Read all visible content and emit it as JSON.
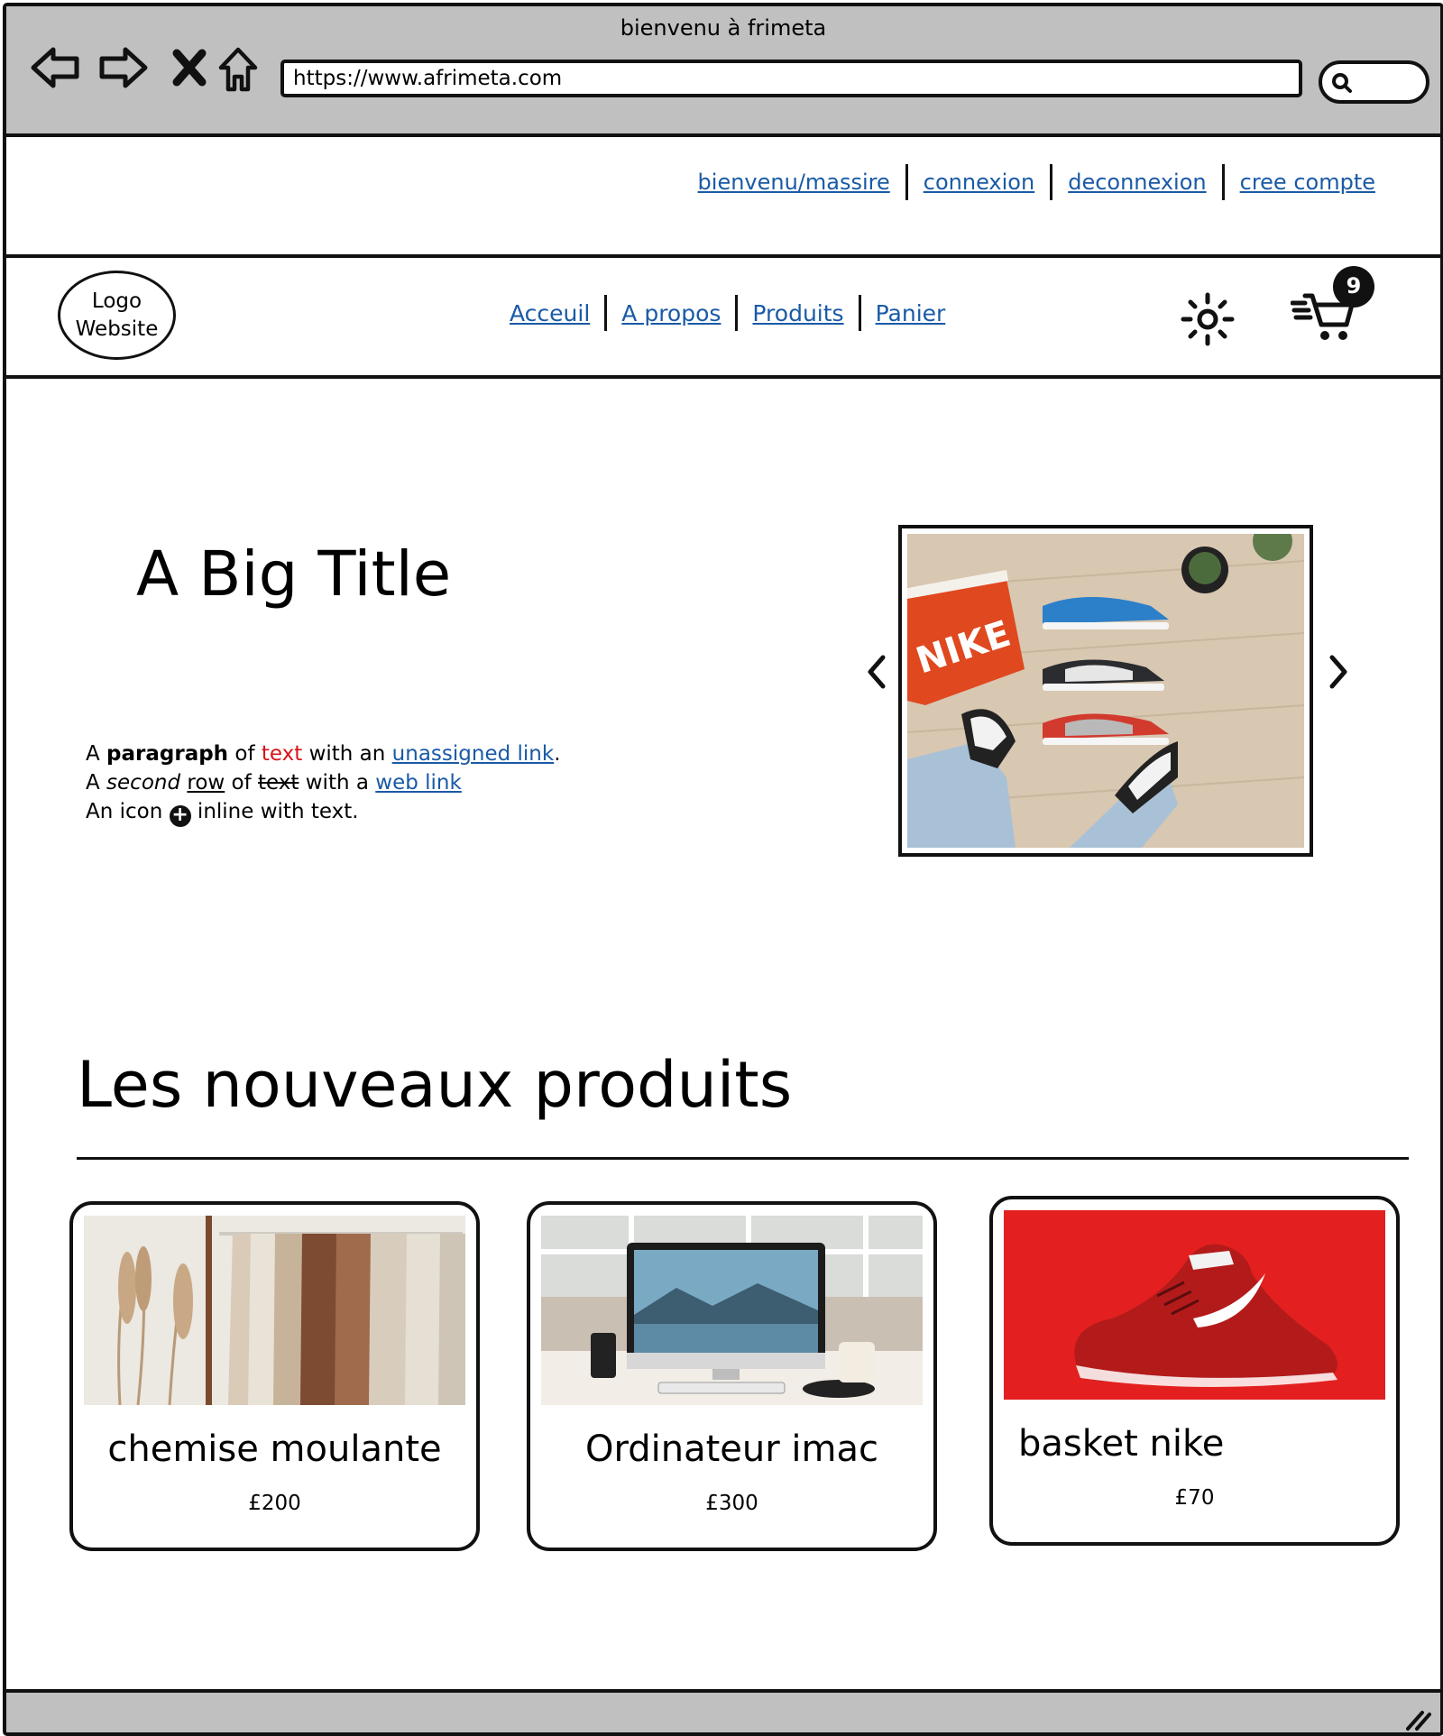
{
  "window": {
    "title": "bienvenu à frimeta",
    "url": "https://www.afrimeta.com"
  },
  "toplinks": [
    "bienvenu/massire",
    "connexion",
    "deconnexion",
    "cree compte"
  ],
  "header": {
    "logo_line1": "Logo",
    "logo_line2": "Website",
    "nav": [
      "Acceuil",
      "A propos",
      "Produits",
      "Panier"
    ],
    "cart_count": "9"
  },
  "hero": {
    "title": "A Big Title",
    "line1": {
      "a": "A ",
      "bold": "paragraph",
      "b": " of ",
      "red": "text",
      "c": " with an ",
      "link": "unassigned link",
      "d": "."
    },
    "line2": {
      "a": "A ",
      "italic": "second",
      "b": " ",
      "underline": "row",
      "c": " of ",
      "strike": "text",
      "d": " with a ",
      "link": "web link"
    },
    "line3": {
      "a": "An icon ",
      "b": " inline with text."
    }
  },
  "section": {
    "title": "Les nouveaux produits"
  },
  "products": [
    {
      "name": "chemise moulante",
      "price": "£200"
    },
    {
      "name": "Ordinateur  imac",
      "price": "£300"
    },
    {
      "name": "basket nike",
      "price": "£70"
    }
  ],
  "colors": {
    "link": "#1a5aa6",
    "accent_red": "#d8141a",
    "chrome": "#c0c0c0"
  }
}
